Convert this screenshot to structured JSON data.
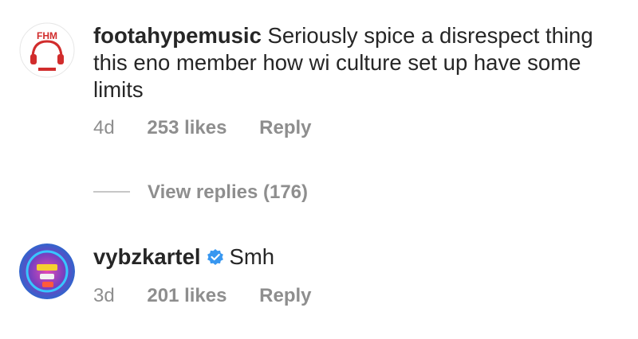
{
  "comments": [
    {
      "username": "footahypemusic",
      "text": "Seriously spice a disrespect thing this eno member how wi culture set up have some limits",
      "time": "4d",
      "likes": "253 likes",
      "reply_label": "Reply",
      "avatar_text": "FHM",
      "view_replies": "View replies (176)"
    },
    {
      "username": "vybzkartel",
      "verified": true,
      "text": "Smh",
      "time": "3d",
      "likes": "201 likes",
      "reply_label": "Reply"
    }
  ],
  "colors": {
    "text": "#262626",
    "secondary": "#8e8e8e",
    "verified_blue": "#3897f0",
    "fhm_red": "#d12c2c"
  }
}
